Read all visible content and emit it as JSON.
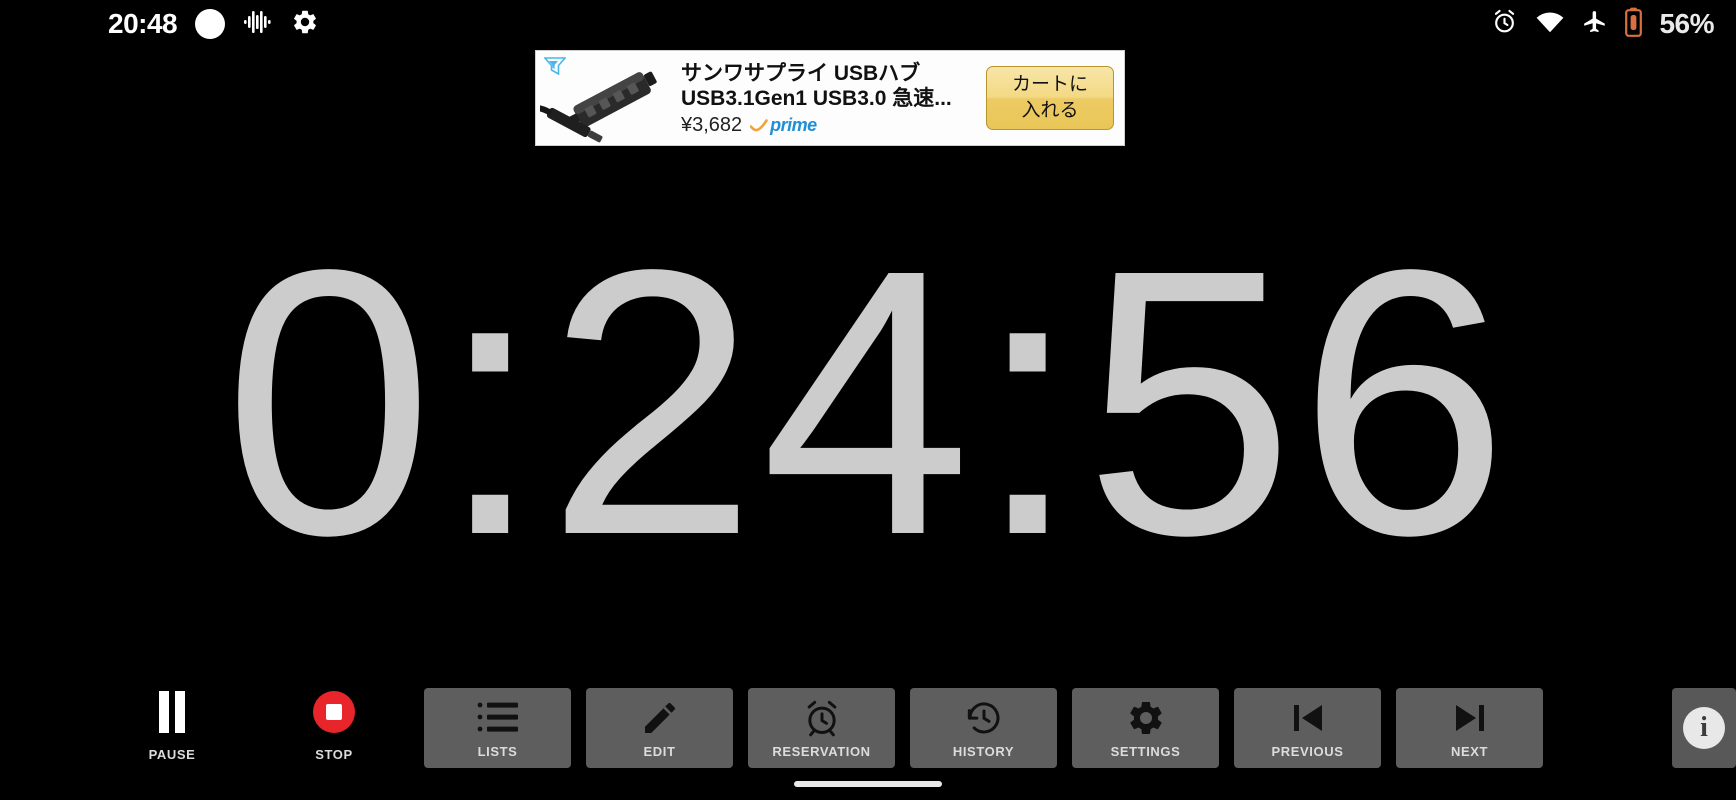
{
  "status_bar": {
    "clock": "20:48",
    "battery_percent": "56%",
    "icons": [
      "recording-dot-icon",
      "audio-waveform-icon",
      "gear-icon",
      "alarm-icon",
      "wifi-icon",
      "airplane-mode-icon",
      "battery-icon"
    ],
    "battery_accent": "#d9703f"
  },
  "ad": {
    "title": "サンワサプライ USBハブ",
    "subtitle": "USB3.1Gen1 USB3.0 急速...",
    "price": "¥3,682",
    "prime_label": "prime",
    "cta_line1": "カートに",
    "cta_line2": "入れる",
    "adchoices_icon": "adchoices-icon",
    "product_icon": "usb-hub-product-image"
  },
  "timer": {
    "display": "0:24:56"
  },
  "controls": {
    "primary": [
      {
        "label": "PAUSE",
        "icon": "pause-icon",
        "color": "#ffffff"
      },
      {
        "label": "STOP",
        "icon": "stop-icon",
        "color": "#e8252a"
      }
    ],
    "buttons": [
      {
        "label": "LISTS",
        "icon": "list-icon"
      },
      {
        "label": "EDIT",
        "icon": "pencil-icon"
      },
      {
        "label": "RESERVATION",
        "icon": "alarm-clock-icon"
      },
      {
        "label": "HISTORY",
        "icon": "history-clock-icon"
      },
      {
        "label": "SETTINGS",
        "icon": "gear-icon"
      },
      {
        "label": "PREVIOUS",
        "icon": "skip-previous-icon"
      },
      {
        "label": "NEXT",
        "icon": "skip-next-icon"
      }
    ],
    "info": {
      "glyph": "i",
      "icon": "info-icon"
    }
  },
  "navigation": {
    "gesture_pill": "home-gesture-pill"
  }
}
